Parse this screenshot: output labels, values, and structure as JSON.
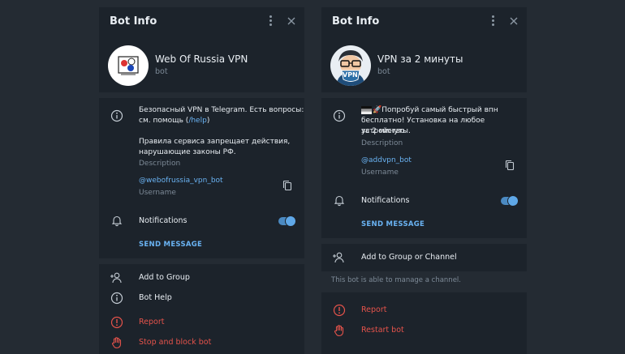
{
  "left": {
    "title": "Bot Info",
    "bot_name": "Web Of Russia VPN",
    "bot_sub": "bot",
    "desc_line1": "Безопасный VPN в Telegram. Есть вопросы:",
    "desc_line2_prefix": "см. помощь (",
    "desc_line2_link": "/help",
    "desc_line2_suffix": ")",
    "desc_line3": "Правила сервиса запрещает действия,",
    "desc_line4": "нарушающие законы РФ.",
    "desc_caption": "Description",
    "username": "@webofrussia_vpn_bot",
    "username_caption": "Username",
    "notifications": "Notifications",
    "send_message": "SEND MESSAGE",
    "add_to_group": "Add to Group",
    "bot_help": "Bot Help",
    "report": "Report",
    "stop_block": "Stop and block bot"
  },
  "right": {
    "title": "Bot Info",
    "bot_name": "VPN за 2 минуты",
    "bot_sub": "bot",
    "avatar_text": "VPN",
    "desc_line1": "🚀Попробуй самый быстрый впн",
    "desc_line2": "бесплатно! Установка на любое устройство",
    "desc_line3": "за 2 минуты.",
    "desc_caption": "Description",
    "username": "@addvpn_bot",
    "username_caption": "Username",
    "notifications": "Notifications",
    "send_message": "SEND MESSAGE",
    "add_to_group": "Add to Group or Channel",
    "manage_note": "This bot is able to manage a channel.",
    "report": "Report",
    "restart": "Restart bot"
  },
  "icons": {
    "info": "info-icon",
    "bell": "bell-icon",
    "copy": "copy-icon",
    "add_user": "add-user-icon",
    "report": "report-icon",
    "hand": "hand-stop-icon",
    "more": "more-vertical-icon",
    "close": "close-icon"
  },
  "colors": {
    "accent": "#6ab3f3",
    "danger": "#e5534b",
    "panel": "#1c232b",
    "background": "#242b33"
  },
  "state": {
    "left_notifications_on": true,
    "right_notifications_on": true
  }
}
